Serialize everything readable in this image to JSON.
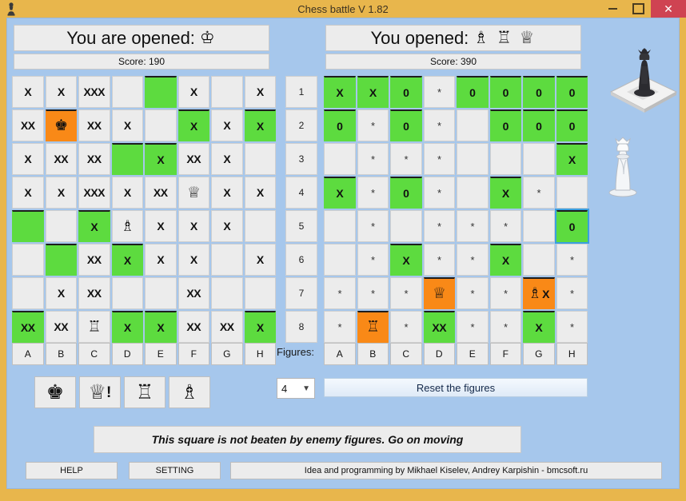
{
  "window": {
    "title": "Chess battle V 1.82",
    "app_icon": "chess-pawn-icon",
    "minimize": "minimize-icon",
    "maximize": "maximize-icon",
    "close": "✕"
  },
  "left_panel": {
    "heading": "You are opened:",
    "heading_pieces": "♔",
    "score": "Score: 190"
  },
  "right_panel": {
    "heading": "You opened:",
    "heading_pieces": "♗ ♖ ♕",
    "score": "Score: 390"
  },
  "left_board": {
    "rows": [
      [
        {
          "t": "X",
          "s": "plain"
        },
        {
          "t": "X",
          "s": "plain"
        },
        {
          "t": "XXX",
          "s": "plain"
        },
        {
          "t": "",
          "s": "plain"
        },
        {
          "t": "",
          "s": "green"
        },
        {
          "t": "X",
          "s": "plain"
        },
        {
          "t": "",
          "s": "plain"
        },
        {
          "t": "X",
          "s": "plain"
        }
      ],
      [
        {
          "t": "XX",
          "s": "plain"
        },
        {
          "t": "",
          "s": "orange",
          "piece": "♚",
          "icon": "king-icon"
        },
        {
          "t": "XX",
          "s": "plain"
        },
        {
          "t": "X",
          "s": "plain"
        },
        {
          "t": "",
          "s": "plain"
        },
        {
          "t": "X",
          "s": "green"
        },
        {
          "t": "X",
          "s": "plain"
        },
        {
          "t": "X",
          "s": "green"
        }
      ],
      [
        {
          "t": "X",
          "s": "plain"
        },
        {
          "t": "XX",
          "s": "plain"
        },
        {
          "t": "XX",
          "s": "plain"
        },
        {
          "t": "",
          "s": "green"
        },
        {
          "t": "X",
          "s": "green"
        },
        {
          "t": "XX",
          "s": "plain"
        },
        {
          "t": "X",
          "s": "plain"
        },
        {
          "t": "",
          "s": "plain"
        }
      ],
      [
        {
          "t": "X",
          "s": "plain"
        },
        {
          "t": "X",
          "s": "plain"
        },
        {
          "t": "XXX",
          "s": "plain"
        },
        {
          "t": "X",
          "s": "plain"
        },
        {
          "t": "XX",
          "s": "plain"
        },
        {
          "t": "",
          "s": "plain",
          "piece": "♕",
          "icon": "queen-icon"
        },
        {
          "t": "X",
          "s": "plain"
        },
        {
          "t": "X",
          "s": "plain"
        }
      ],
      [
        {
          "t": "",
          "s": "green"
        },
        {
          "t": "",
          "s": "plain"
        },
        {
          "t": "X",
          "s": "green"
        },
        {
          "t": "",
          "s": "plain",
          "piece": "♗",
          "icon": "bishop-icon"
        },
        {
          "t": "X",
          "s": "plain"
        },
        {
          "t": "X",
          "s": "plain"
        },
        {
          "t": "X",
          "s": "plain"
        },
        {
          "t": "",
          "s": "plain"
        }
      ],
      [
        {
          "t": "",
          "s": "plain"
        },
        {
          "t": "",
          "s": "green"
        },
        {
          "t": "XX",
          "s": "plain"
        },
        {
          "t": "X",
          "s": "green"
        },
        {
          "t": "X",
          "s": "plain"
        },
        {
          "t": "X",
          "s": "plain"
        },
        {
          "t": "",
          "s": "plain"
        },
        {
          "t": "X",
          "s": "plain"
        }
      ],
      [
        {
          "t": "",
          "s": "plain"
        },
        {
          "t": "X",
          "s": "plain"
        },
        {
          "t": "XX",
          "s": "plain"
        },
        {
          "t": "",
          "s": "plain"
        },
        {
          "t": "",
          "s": "plain"
        },
        {
          "t": "XX",
          "s": "plain"
        },
        {
          "t": "",
          "s": "plain"
        },
        {
          "t": "",
          "s": "plain"
        }
      ],
      [
        {
          "t": "XX",
          "s": "green"
        },
        {
          "t": "XX",
          "s": "plain"
        },
        {
          "t": "",
          "s": "plain",
          "piece": "♖",
          "icon": "rook-icon"
        },
        {
          "t": "X",
          "s": "green"
        },
        {
          "t": "X",
          "s": "green"
        },
        {
          "t": "XX",
          "s": "plain"
        },
        {
          "t": "XX",
          "s": "plain"
        },
        {
          "t": "X",
          "s": "green"
        }
      ]
    ]
  },
  "row_numbers": [
    "1",
    "2",
    "3",
    "4",
    "5",
    "6",
    "7",
    "8"
  ],
  "right_board": {
    "rows": [
      [
        {
          "t": "X",
          "s": "green"
        },
        {
          "t": "X",
          "s": "green"
        },
        {
          "t": "0",
          "s": "green"
        },
        {
          "t": "*",
          "s": "star"
        },
        {
          "t": "0",
          "s": "green"
        },
        {
          "t": "0",
          "s": "green"
        },
        {
          "t": "0",
          "s": "green"
        },
        {
          "t": "0",
          "s": "green"
        }
      ],
      [
        {
          "t": "0",
          "s": "green"
        },
        {
          "t": "*",
          "s": "star"
        },
        {
          "t": "0",
          "s": "green"
        },
        {
          "t": "*",
          "s": "star"
        },
        {
          "t": "",
          "s": "plain"
        },
        {
          "t": "0",
          "s": "green"
        },
        {
          "t": "0",
          "s": "green"
        },
        {
          "t": "0",
          "s": "green"
        }
      ],
      [
        {
          "t": "",
          "s": "plain"
        },
        {
          "t": "*",
          "s": "star"
        },
        {
          "t": "*",
          "s": "star"
        },
        {
          "t": "*",
          "s": "star"
        },
        {
          "t": "",
          "s": "plain"
        },
        {
          "t": "",
          "s": "plain"
        },
        {
          "t": "",
          "s": "plain"
        },
        {
          "t": "X",
          "s": "green"
        }
      ],
      [
        {
          "t": "X",
          "s": "green"
        },
        {
          "t": "*",
          "s": "star"
        },
        {
          "t": "0",
          "s": "green"
        },
        {
          "t": "*",
          "s": "star"
        },
        {
          "t": "",
          "s": "plain"
        },
        {
          "t": "X",
          "s": "green"
        },
        {
          "t": "*",
          "s": "star"
        },
        {
          "t": "",
          "s": "plain"
        }
      ],
      [
        {
          "t": "",
          "s": "plain"
        },
        {
          "t": "*",
          "s": "star"
        },
        {
          "t": "",
          "s": "plain"
        },
        {
          "t": "*",
          "s": "star"
        },
        {
          "t": "*",
          "s": "star"
        },
        {
          "t": "*",
          "s": "star"
        },
        {
          "t": "",
          "s": "plain"
        },
        {
          "t": "0",
          "s": "green",
          "focus": true
        }
      ],
      [
        {
          "t": "",
          "s": "plain"
        },
        {
          "t": "*",
          "s": "star"
        },
        {
          "t": "X",
          "s": "green"
        },
        {
          "t": "*",
          "s": "star"
        },
        {
          "t": "*",
          "s": "star"
        },
        {
          "t": "X",
          "s": "green"
        },
        {
          "t": "",
          "s": "plain"
        },
        {
          "t": "*",
          "s": "star"
        }
      ],
      [
        {
          "t": "*",
          "s": "star"
        },
        {
          "t": "*",
          "s": "star"
        },
        {
          "t": "*",
          "s": "star"
        },
        {
          "t": "",
          "s": "orange",
          "piece": "♕",
          "icon": "queen-icon"
        },
        {
          "t": "*",
          "s": "star"
        },
        {
          "t": "*",
          "s": "star"
        },
        {
          "t": "X",
          "s": "orange",
          "piece": "♗",
          "icon": "bishop-icon"
        },
        {
          "t": "*",
          "s": "star"
        }
      ],
      [
        {
          "t": "*",
          "s": "star"
        },
        {
          "t": "",
          "s": "orange",
          "piece": "♖",
          "icon": "rook-icon"
        },
        {
          "t": "*",
          "s": "star"
        },
        {
          "t": "XX",
          "s": "green"
        },
        {
          "t": "*",
          "s": "star"
        },
        {
          "t": "*",
          "s": "star"
        },
        {
          "t": "X",
          "s": "green"
        },
        {
          "t": "*",
          "s": "star"
        }
      ]
    ]
  },
  "left_letters": [
    "A",
    "B",
    "C",
    "D",
    "E",
    "F",
    "G",
    "H"
  ],
  "right_letters": [
    "A",
    "B",
    "C",
    "D",
    "E",
    "F",
    "G",
    "H"
  ],
  "piece_buttons": [
    {
      "glyph": "♚",
      "name": "king-button",
      "bang": ""
    },
    {
      "glyph": "♕",
      "name": "queen-button",
      "bang": "!"
    },
    {
      "glyph": "♖",
      "name": "rook-button",
      "bang": ""
    },
    {
      "glyph": "♗",
      "name": "bishop-button",
      "bang": ""
    }
  ],
  "figures": {
    "label": "Figures:",
    "value": "4",
    "caret": "▼"
  },
  "reset_button": "Reset the figures",
  "status_message": "This square is not beaten by enemy figures. Go on moving",
  "footer": {
    "help": "HELP",
    "setting": "SETTING",
    "credits": "Idea and programming by Mikhael  Kiselev, Andrey Karpishin - bmcsoft.ru"
  },
  "colors": {
    "titlebar": "#e8b64c",
    "client": "#a6c7ec",
    "green": "#5ddb3f",
    "orange": "#f98917",
    "close": "#cf4352"
  }
}
